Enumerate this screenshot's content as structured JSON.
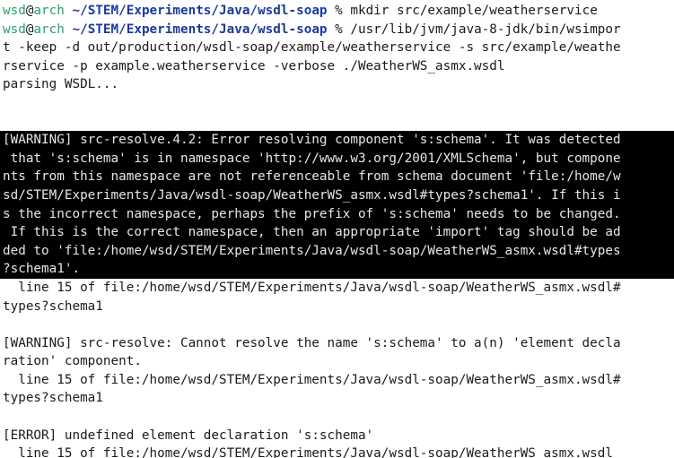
{
  "prompt": {
    "user": "wsd",
    "at": "@",
    "host": "arch",
    "path": "~/STEM/Experiments/Java/wsdl-soap",
    "symbol": "%"
  },
  "commands": [
    " mkdir src/example/weatherservice",
    " /usr/lib/jvm/java-8-jdk/bin/wsimpor"
  ],
  "command_continuation": [
    "t -keep -d out/production/wsdl-soap/example/weatherservice -s src/example/weathe",
    "rservice -p example.weatherservice -verbose ./WeatherWS_asmx.wsdl"
  ],
  "output_pre": [
    "parsing WSDL...",
    "",
    ""
  ],
  "highlighted_block": [
    "[WARNING] src-resolve.4.2: Error resolving component 's:schema'. It was detected",
    " that 's:schema' is in namespace 'http://www.w3.org/2001/XMLSchema', but compone",
    "nts from this namespace are not referenceable from schema document 'file:/home/w",
    "sd/STEM/Experiments/Java/wsdl-soap/WeatherWS_asmx.wsdl#types?schema1'. If this i",
    "s the incorrect namespace, perhaps the prefix of 's:schema' needs to be changed.",
    " If this is the correct namespace, then an appropriate 'import' tag should be ad",
    "ded to 'file:/home/wsd/STEM/Experiments/Java/wsdl-soap/WeatherWS_asmx.wsdl#types",
    "?schema1'."
  ],
  "output_post": [
    "  line 15 of file:/home/wsd/STEM/Experiments/Java/wsdl-soap/WeatherWS_asmx.wsdl#",
    "types?schema1",
    "",
    "[WARNING] src-resolve: Cannot resolve the name 's:schema' to a(n) 'element decla",
    "ration' component.",
    "  line 15 of file:/home/wsd/STEM/Experiments/Java/wsdl-soap/WeatherWS_asmx.wsdl#",
    "types?schema1",
    "",
    "[ERROR] undefined element declaration 's:schema'",
    "  line 15 of file:/home/wsd/STEM/Experiments/Java/wsdl-soap/WeatherWS_asmx.wsdl"
  ],
  "colors": {
    "background": "#ffffff",
    "text": "#1a1a1a",
    "prompt_user": "#26a269",
    "prompt_path": "#1c3a9e",
    "highlight_bg": "#000000",
    "highlight_fg": "#e6e6e6"
  }
}
